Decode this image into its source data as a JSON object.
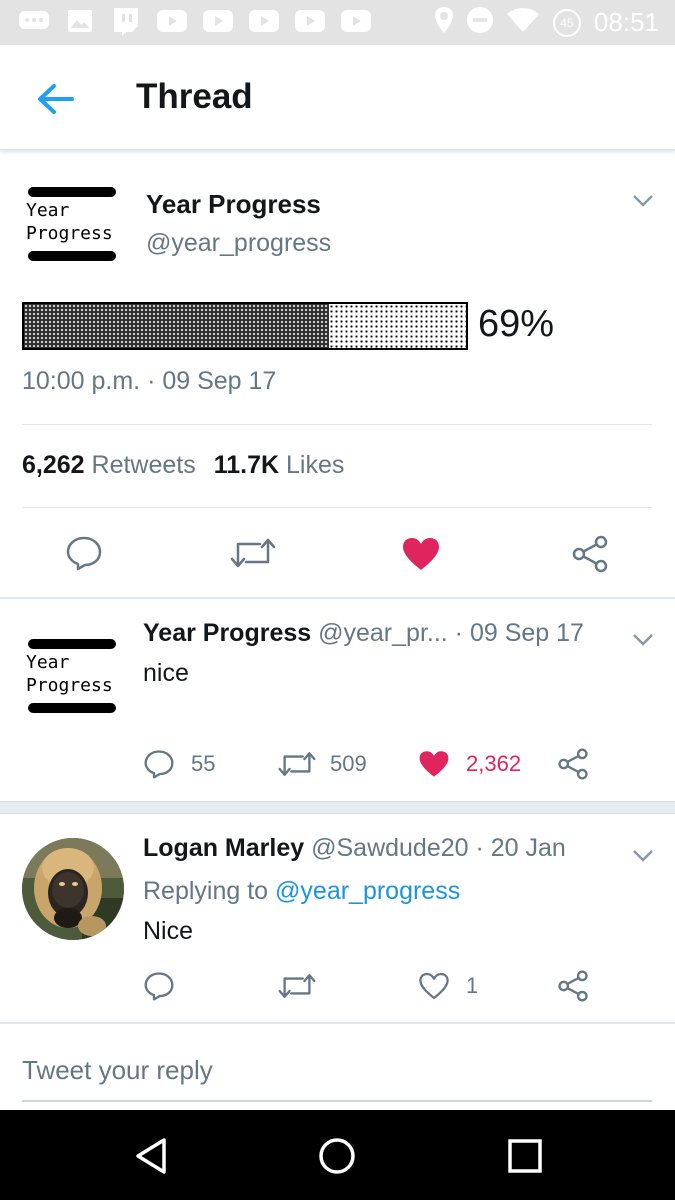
{
  "status_bar": {
    "time": "08:51",
    "battery_level": "45",
    "left_icons": [
      "message-icon",
      "image-icon",
      "twitch-icon",
      "youtube-icon",
      "youtube-icon",
      "youtube-icon",
      "youtube-icon",
      "youtube-icon"
    ],
    "right_icons": [
      "location-icon",
      "do-not-disturb-icon",
      "wifi-icon",
      "battery-icon"
    ]
  },
  "app_bar": {
    "title": "Thread",
    "back_icon": "arrow-left-icon"
  },
  "main_tweet": {
    "logo_text_line1": "Year",
    "logo_text_line2": "Progress",
    "name": "Year Progress",
    "handle": "@year_progress",
    "progress_fraction": 0.69,
    "progress_label": "69%",
    "timestamp": "10:00 p.m. · 09 Sep 17",
    "retweets_count": "6,262",
    "retweets_label": "Retweets",
    "likes_count": "11.7K",
    "likes_label": "Likes"
  },
  "reply_1": {
    "name": "Year Progress",
    "handle_date": "@year_pr... · 09 Sep 17",
    "logo_text_line1": "Year",
    "logo_text_line2": "Progress",
    "text": "nice",
    "replies": "55",
    "retweets": "509",
    "likes": "2,362",
    "liked": true
  },
  "reply_2": {
    "name": "Logan Marley",
    "handle_date": "@Sawdude20 · 20 Jan",
    "replying_prefix": "Replying to",
    "replying_mention": "@year_progress",
    "text": "Nice",
    "likes": "1",
    "liked": false
  },
  "compose": {
    "placeholder": "Tweet your reply"
  },
  "colors": {
    "accent": "#1da1f2",
    "like": "#e0245e",
    "secondary_text": "#657786",
    "mention": "#1b95e0"
  }
}
